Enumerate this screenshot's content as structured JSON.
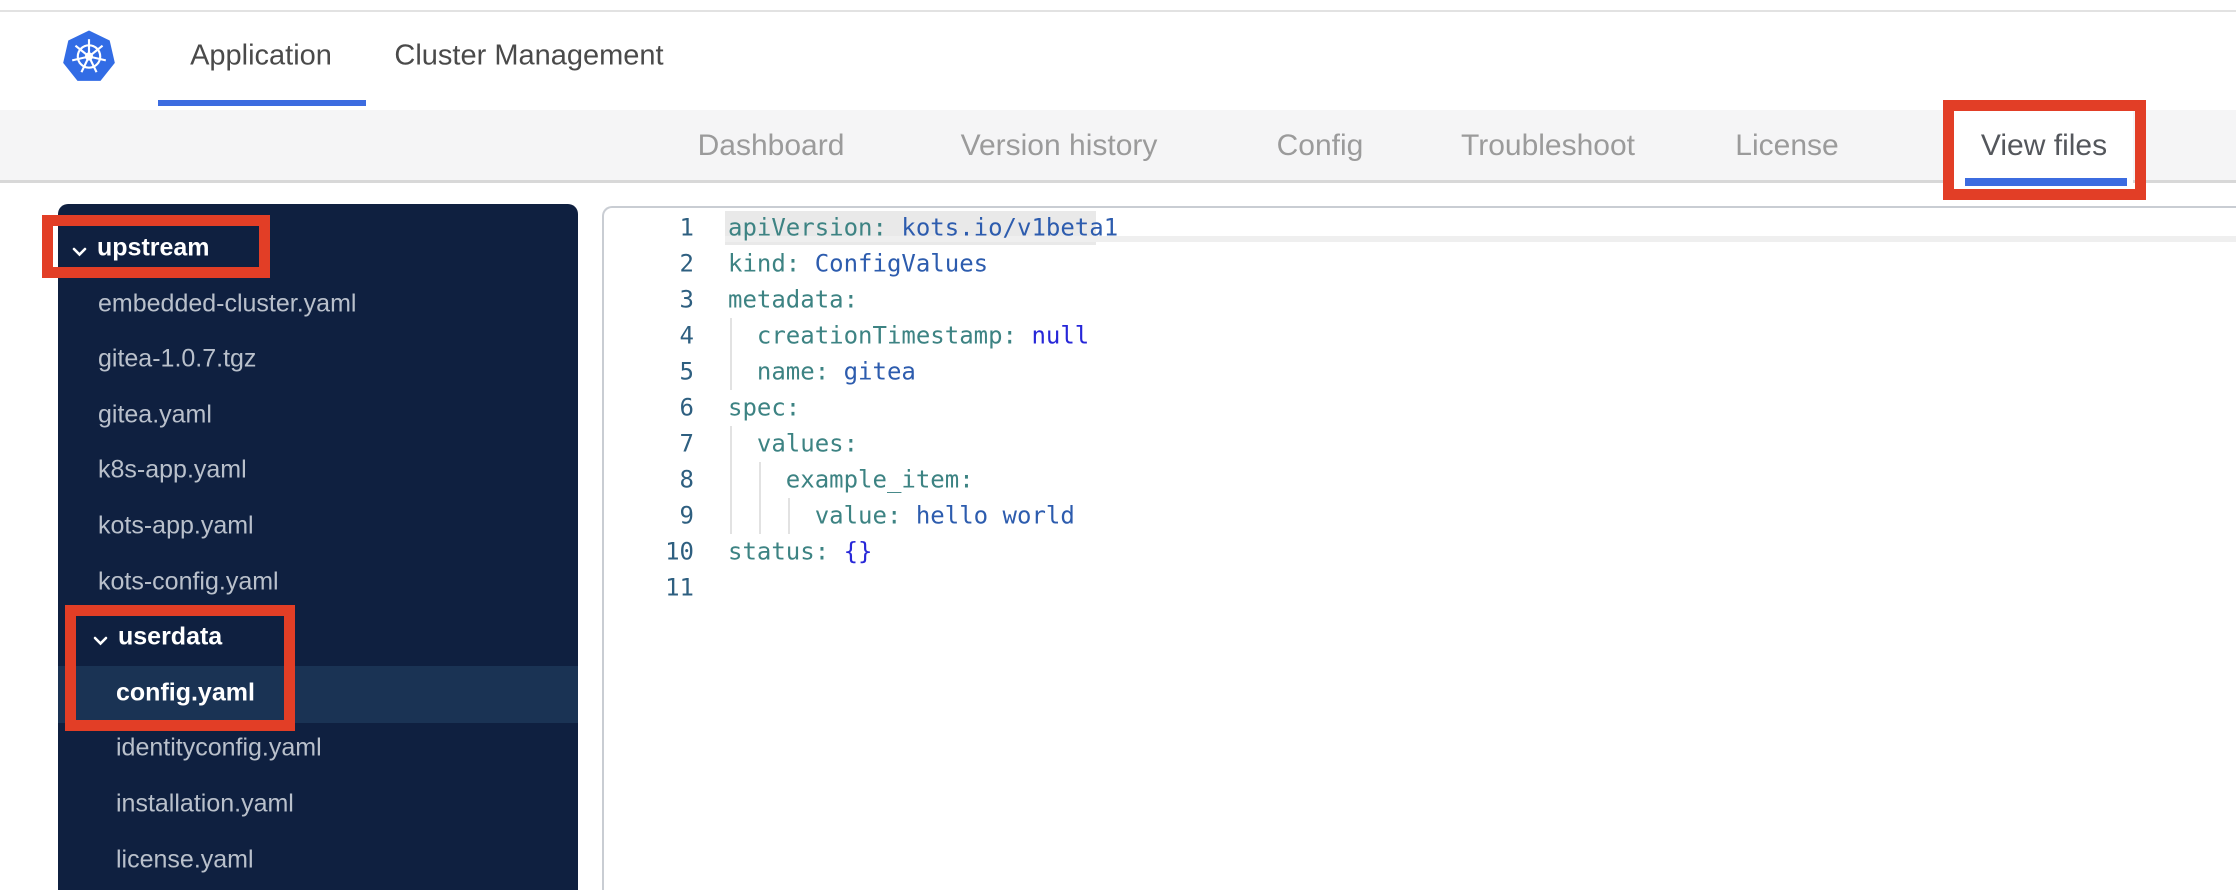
{
  "colors": {
    "accent_blue": "#3c6ce0",
    "annotation_red": "#e23e26",
    "sidebar_bg": "#0f2040",
    "sidebar_selected_bg": "#1a3354",
    "logo_blue": "#326ce5"
  },
  "header": {
    "logo": "kubernetes-logo",
    "tabs": [
      {
        "label": "Application",
        "active": true
      },
      {
        "label": "Cluster Management",
        "active": false
      }
    ]
  },
  "subnav": {
    "items": [
      {
        "label": "Dashboard",
        "active": false
      },
      {
        "label": "Version history",
        "active": false
      },
      {
        "label": "Config",
        "active": false
      },
      {
        "label": "Troubleshoot",
        "active": false
      },
      {
        "label": "License",
        "active": false
      },
      {
        "label": "View files",
        "active": true
      }
    ]
  },
  "annotations": {
    "highlighted_items": [
      "View files",
      "upstream",
      "userdata / config.yaml"
    ]
  },
  "file_tree": [
    {
      "label": "upstream",
      "type": "folder",
      "depth": 0,
      "expanded": true,
      "selected": false
    },
    {
      "label": "embedded-cluster.yaml",
      "type": "file",
      "depth": 1,
      "selected": false
    },
    {
      "label": "gitea-1.0.7.tgz",
      "type": "file",
      "depth": 1,
      "selected": false
    },
    {
      "label": "gitea.yaml",
      "type": "file",
      "depth": 1,
      "selected": false
    },
    {
      "label": "k8s-app.yaml",
      "type": "file",
      "depth": 1,
      "selected": false
    },
    {
      "label": "kots-app.yaml",
      "type": "file",
      "depth": 1,
      "selected": false
    },
    {
      "label": "kots-config.yaml",
      "type": "file",
      "depth": 1,
      "selected": false
    },
    {
      "label": "userdata",
      "type": "folder",
      "depth": 1,
      "expanded": true,
      "selected": false
    },
    {
      "label": "config.yaml",
      "type": "file",
      "depth": 2,
      "selected": true
    },
    {
      "label": "identityconfig.yaml",
      "type": "file",
      "depth": 2,
      "selected": false
    },
    {
      "label": "installation.yaml",
      "type": "file",
      "depth": 2,
      "selected": false
    },
    {
      "label": "license.yaml",
      "type": "file",
      "depth": 2,
      "selected": false
    }
  ],
  "editor": {
    "lines": [
      {
        "num": "1",
        "guides": 0,
        "tokens": [
          [
            "apiVersion:",
            "k"
          ],
          [
            " ",
            ""
          ],
          [
            "kots.io/v1beta1",
            "v"
          ]
        ]
      },
      {
        "num": "2",
        "guides": 0,
        "tokens": [
          [
            "kind:",
            "k"
          ],
          [
            " ",
            ""
          ],
          [
            "ConfigValues",
            "v"
          ]
        ]
      },
      {
        "num": "3",
        "guides": 0,
        "tokens": [
          [
            "metadata:",
            "k"
          ]
        ]
      },
      {
        "num": "4",
        "guides": 1,
        "tokens": [
          [
            "  ",
            ""
          ],
          [
            "creationTimestamp:",
            "k"
          ],
          [
            " ",
            ""
          ],
          [
            "null",
            "n"
          ]
        ]
      },
      {
        "num": "5",
        "guides": 1,
        "tokens": [
          [
            "  ",
            ""
          ],
          [
            "name:",
            "k"
          ],
          [
            " ",
            ""
          ],
          [
            "gitea",
            "v"
          ]
        ]
      },
      {
        "num": "6",
        "guides": 0,
        "tokens": [
          [
            "spec:",
            "k"
          ]
        ]
      },
      {
        "num": "7",
        "guides": 1,
        "tokens": [
          [
            "  ",
            ""
          ],
          [
            "values:",
            "k"
          ]
        ]
      },
      {
        "num": "8",
        "guides": 2,
        "tokens": [
          [
            "    ",
            ""
          ],
          [
            "example_item:",
            "k"
          ]
        ]
      },
      {
        "num": "9",
        "guides": 3,
        "tokens": [
          [
            "      ",
            ""
          ],
          [
            "value:",
            "k"
          ],
          [
            " ",
            ""
          ],
          [
            "hello world",
            "v"
          ]
        ]
      },
      {
        "num": "10",
        "guides": 0,
        "tokens": [
          [
            "status:",
            "k"
          ],
          [
            " ",
            ""
          ],
          [
            "{}",
            "n"
          ]
        ]
      },
      {
        "num": "11",
        "guides": 0,
        "tokens": []
      }
    ]
  }
}
